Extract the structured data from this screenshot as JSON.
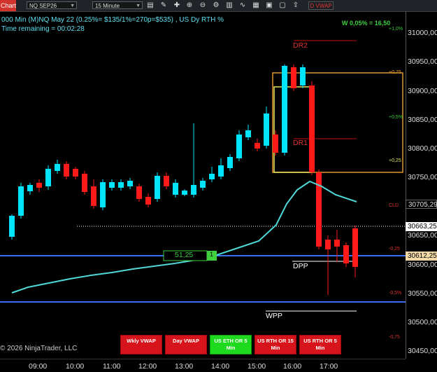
{
  "toolbar": {
    "title": "Chart",
    "instrument": "NQ SEP26",
    "timeframe": "15 Minute",
    "vwap_label": "D VWAP"
  },
  "header": {
    "line1": "000 Min (M)NQ May 22 (0.25%= $135/1%=270p=$535) , US Dy RTH %",
    "line2": "Time remaining = 00:02:28",
    "range_info": "W 0,05% = 16,50"
  },
  "price_axis": [
    "31000,00",
    "30950,00",
    "30900,00",
    "30850,00",
    "30800,00",
    "30750,00",
    "30650,00",
    "30600,00",
    "30550,00",
    "30500,00",
    "30450,00"
  ],
  "time_axis": [
    "09:00",
    "10:00",
    "11:00",
    "12:00",
    "13:00",
    "14:00",
    "15:00",
    "16:00",
    "17:00"
  ],
  "price_tags": {
    "cloud": "30705,29",
    "last": "30663,25",
    "dpp": "30612,25"
  },
  "pct_labels": [
    "+1,0%",
    "+0,75",
    "+0,5%",
    "+0,25",
    "-0,25",
    "-0,5%",
    "-0,75"
  ],
  "cld_label": "CLD",
  "levels": {
    "dr2": "DR2",
    "dr1": "DR1",
    "dpp": "DPP",
    "wpp": "WPP"
  },
  "position": {
    "price": "51,25",
    "qty": "1"
  },
  "buttons": [
    {
      "label": "Wkly VWAP",
      "color": "red"
    },
    {
      "label": "Day VWAP",
      "color": "red"
    },
    {
      "label": "US ETH OR 5 Min",
      "color": "green"
    },
    {
      "label": "US RTH OR 15 Min",
      "color": "red"
    },
    {
      "label": "US RTH OR 5 Min",
      "color": "red"
    }
  ],
  "copyright": "© 2026 NinjaTrader, LLC",
  "colors": {
    "bull": "#00e5ff",
    "bear": "#ff1a1a",
    "vwap": "#4fd8d8",
    "dpp_line": "#3a6ef0"
  }
}
